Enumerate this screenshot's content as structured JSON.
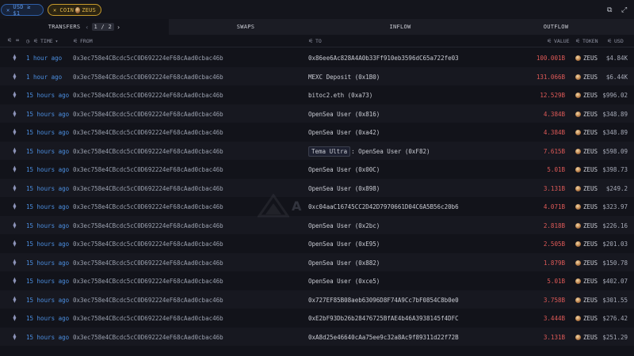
{
  "filters": {
    "usd_chip": "USD ≥ $1",
    "coin_chip_prefix": "COIN",
    "coin_chip_token": "ZEUS"
  },
  "top_icons": [
    "copy-icon",
    "expand-icon"
  ],
  "tabs": {
    "transfers": "TRANSFERS",
    "transfers_page": "1 / 2",
    "swaps": "SWAPS",
    "inflow": "INFLOW",
    "outflow": "OUTFLOW"
  },
  "columns": {
    "time": "TIME",
    "from": "FROM",
    "to": "TO",
    "value": "VALUE",
    "token": "TOKEN",
    "usd": "USD"
  },
  "watermark": "A",
  "rows": [
    {
      "time": "1 hour ago",
      "from": "0x3ec758e4CBcdc5cC0D692224eF68cAad0cbac46b",
      "to_badge": "",
      "to": "0x86ee6Ac828A4A0b33Ff910eb3596dC65a722fe03",
      "value": "100.001B",
      "token": "ZEUS",
      "usd": "$4.84K"
    },
    {
      "time": "1 hour ago",
      "from": "0x3ec758e4CBcdc5cC0D692224eF68cAad0cbac46b",
      "to_badge": "",
      "to": "MEXC Deposit (0x1B0)",
      "value": "131.066B",
      "token": "ZEUS",
      "usd": "$6.44K"
    },
    {
      "time": "15 hours ago",
      "from": "0x3ec758e4CBcdc5cC0D692224eF68cAad0cbac46b",
      "to_badge": "",
      "to": "bitoc2.eth (0xa73)",
      "value": "12.529B",
      "token": "ZEUS",
      "usd": "$996.02"
    },
    {
      "time": "15 hours ago",
      "from": "0x3ec758e4CBcdc5cC0D692224eF68cAad0cbac46b",
      "to_badge": "",
      "to": "OpenSea User (0x816)",
      "value": "4.384B",
      "token": "ZEUS",
      "usd": "$348.89"
    },
    {
      "time": "15 hours ago",
      "from": "0x3ec758e4CBcdc5cC0D692224eF68cAad0cbac46b",
      "to_badge": "",
      "to": "OpenSea User (0xa42)",
      "value": "4.384B",
      "token": "ZEUS",
      "usd": "$348.89"
    },
    {
      "time": "15 hours ago",
      "from": "0x3ec758e4CBcdc5cC0D692224eF68cAad0cbac46b",
      "to_badge": "Tema Ultra",
      "to": ": OpenSea User (0xF82)",
      "value": "7.615B",
      "token": "ZEUS",
      "usd": "$598.09"
    },
    {
      "time": "15 hours ago",
      "from": "0x3ec758e4CBcdc5cC0D692224eF68cAad0cbac46b",
      "to_badge": "",
      "to": "OpenSea User (0x00C)",
      "value": "5.01B",
      "token": "ZEUS",
      "usd": "$398.73"
    },
    {
      "time": "15 hours ago",
      "from": "0x3ec758e4CBcdc5cC0D692224eF68cAad0cbac46b",
      "to_badge": "",
      "to": "OpenSea User (0x898)",
      "value": "3.131B",
      "token": "ZEUS",
      "usd": "$249.2"
    },
    {
      "time": "15 hours ago",
      "from": "0x3ec758e4CBcdc5cC0D692224eF68cAad0cbac46b",
      "to_badge": "",
      "to": "0xc04aaC16745CC2D42D7970661D04C6A5B56c20b6",
      "value": "4.071B",
      "token": "ZEUS",
      "usd": "$323.97"
    },
    {
      "time": "15 hours ago",
      "from": "0x3ec758e4CBcdc5cC0D692224eF68cAad0cbac46b",
      "to_badge": "",
      "to": "OpenSea User (0x2bc)",
      "value": "2.818B",
      "token": "ZEUS",
      "usd": "$226.16"
    },
    {
      "time": "15 hours ago",
      "from": "0x3ec758e4CBcdc5cC0D692224eF68cAad0cbac46b",
      "to_badge": "",
      "to": "OpenSea User (0xE95)",
      "value": "2.505B",
      "token": "ZEUS",
      "usd": "$201.03"
    },
    {
      "time": "15 hours ago",
      "from": "0x3ec758e4CBcdc5cC0D692224eF68cAad0cbac46b",
      "to_badge": "",
      "to": "OpenSea User (0x882)",
      "value": "1.879B",
      "token": "ZEUS",
      "usd": "$150.78"
    },
    {
      "time": "15 hours ago",
      "from": "0x3ec758e4CBcdc5cC0D692224eF68cAad0cbac46b",
      "to_badge": "",
      "to": "OpenSea User (0xce5)",
      "value": "5.01B",
      "token": "ZEUS",
      "usd": "$402.07"
    },
    {
      "time": "15 hours ago",
      "from": "0x3ec758e4CBcdc5cC0D692224eF68cAad0cbac46b",
      "to_badge": "",
      "to": "0x727EF85B08aeb63096D8F74A9Cc7bF0854C8b0e0",
      "value": "3.758B",
      "token": "ZEUS",
      "usd": "$301.55"
    },
    {
      "time": "15 hours ago",
      "from": "0x3ec758e4CBcdc5cC0D692224eF68cAad0cbac46b",
      "to_badge": "",
      "to": "0xE2bF93Db26b28476725BfAE4b46A3938145f4DFC",
      "value": "3.444B",
      "token": "ZEUS",
      "usd": "$276.42"
    },
    {
      "time": "15 hours ago",
      "from": "0x3ec758e4CBcdc5cC0D692224eF68cAad0cbac46b",
      "to_badge": "",
      "to": "0xA8d25e46640cAa75ee9c32a8Ac9f89311d22f72B",
      "value": "3.131B",
      "token": "ZEUS",
      "usd": "$251.29"
    }
  ]
}
